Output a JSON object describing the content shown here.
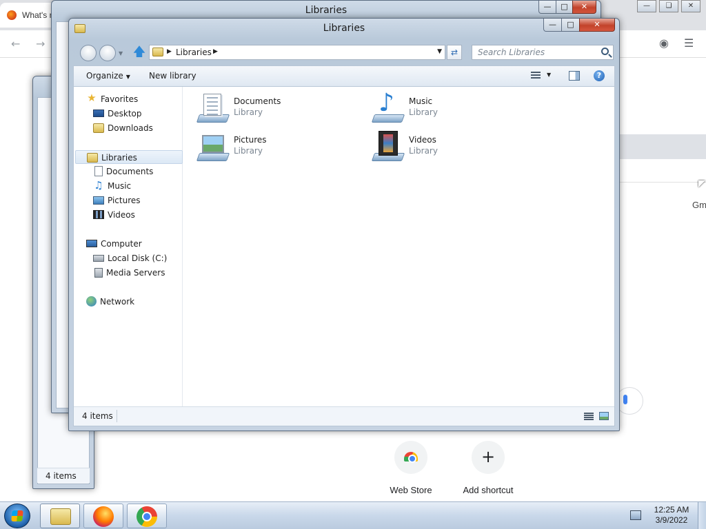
{
  "background_browser": {
    "tab_title": "What's n",
    "partial_text": "Gm",
    "shortcuts": [
      {
        "label": "Web Store",
        "icon": "web-store-icon"
      },
      {
        "label": "Add shortcut",
        "icon": "plus-icon"
      }
    ]
  },
  "back_windows": {
    "title": "Libraries",
    "status": "4 items"
  },
  "explorer": {
    "title": "Libraries",
    "address": {
      "path": "Libraries"
    },
    "search": {
      "placeholder": "Search Libraries"
    },
    "commands": {
      "organize": "Organize",
      "new_library": "New library"
    },
    "nav": {
      "favorites": {
        "label": "Favorites",
        "items": [
          "Desktop",
          "Downloads"
        ]
      },
      "libraries": {
        "label": "Libraries",
        "items": [
          "Documents",
          "Music",
          "Pictures",
          "Videos"
        ]
      },
      "computer": {
        "label": "Computer",
        "items": [
          "Local Disk (C:)",
          "Media Servers"
        ]
      },
      "network": {
        "label": "Network"
      }
    },
    "libraries": [
      {
        "name": "Documents",
        "type": "Library",
        "icon": "documents-library-icon"
      },
      {
        "name": "Music",
        "type": "Library",
        "icon": "music-library-icon"
      },
      {
        "name": "Pictures",
        "type": "Library",
        "icon": "pictures-library-icon"
      },
      {
        "name": "Videos",
        "type": "Library",
        "icon": "videos-library-icon"
      }
    ],
    "status": {
      "count": "4 items"
    }
  },
  "taskbar": {
    "clock_time": "12:25 AM",
    "clock_date": "3/9/2022",
    "buttons": [
      "windows-explorer",
      "firefox",
      "chrome"
    ]
  }
}
